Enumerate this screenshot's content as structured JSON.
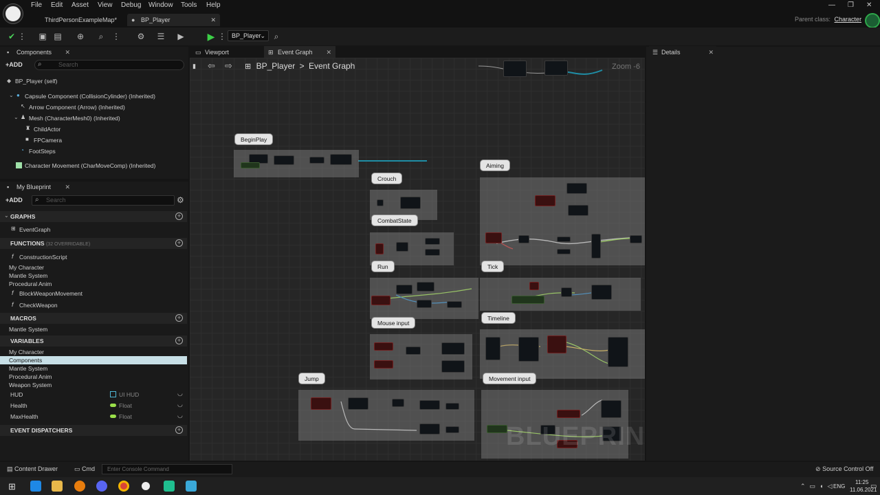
{
  "menu": [
    "File",
    "Edit",
    "Asset",
    "View",
    "Debug",
    "Window",
    "Tools",
    "Help"
  ],
  "doc_tabs": [
    {
      "label": "ThirdPersonExampleMap*"
    },
    {
      "label": "BP_Player"
    }
  ],
  "parent_class": {
    "label": "Parent class:",
    "value": "Character"
  },
  "toolbar": {
    "blueprint_select": "BP_Player"
  },
  "components_panel": {
    "tab": "Components",
    "add": "ADD",
    "search_placeholder": "Search",
    "items": [
      "BP_Player  (self)",
      "Capsule Component (CollisionCylinder) (Inherited)",
      "Arrow Component (Arrow) (Inherited)",
      "Mesh (CharacterMesh0) (Inherited)",
      "ChildActor",
      "FPCamera",
      "FootSteps",
      "Character Movement (CharMoveComp) (Inherited)"
    ]
  },
  "myblueprint": {
    "tab": "My Blueprint",
    "add": "ADD",
    "search_placeholder": "Search",
    "graphs": {
      "title": "GRAPHS",
      "items": [
        "EventGraph"
      ]
    },
    "functions": {
      "title": "FUNCTIONS",
      "note": "(32 OVERRIDABLE)",
      "items": [
        "ConstructionScript",
        "My Character",
        "Mantle System",
        "Procedural Anim",
        "BlockWeaponMovement",
        "CheckWeapon"
      ]
    },
    "macros": {
      "title": "MACROS",
      "items": [
        "Mantle System"
      ]
    },
    "variables": {
      "title": "VARIABLES",
      "categories": [
        "My Character",
        "Components",
        "Mantle System",
        "Procedural Anim",
        "Weapon System"
      ],
      "vars": [
        {
          "name": "HUD",
          "type": "UI HUD",
          "color": "#4fb8d8"
        },
        {
          "name": "Health",
          "type": "Float",
          "color": "#9be04a"
        },
        {
          "name": "MaxHealth",
          "type": "Float",
          "color": "#9be04a"
        }
      ]
    },
    "dispatchers": {
      "title": "EVENT DISPATCHERS"
    }
  },
  "graph": {
    "tabs": [
      {
        "label": "Viewport"
      },
      {
        "label": "Event Graph"
      }
    ],
    "breadcrumb": {
      "root": "BP_Player",
      "sep": ">",
      "current": "Event Graph"
    },
    "zoom": "Zoom -6",
    "comments": [
      "BeginPlay",
      "Crouch",
      "CombatState",
      "Run",
      "Mouse input",
      "Jump",
      "Aiming",
      "Tick",
      "Timeline",
      "Movement input"
    ],
    "watermark": "BLUEPRINT"
  },
  "details": {
    "tab": "Details"
  },
  "statusbar": {
    "content_drawer": "Content Drawer",
    "cmd": "Cmd",
    "console_placeholder": "Enter Console Command",
    "source_control": "Source Control Off"
  },
  "taskbar": {
    "lang": "ENG",
    "time": "11:25",
    "date": "11.06.2021"
  },
  "colors": {
    "accent": "#2aa63b",
    "selected": "#c7dfe6"
  }
}
